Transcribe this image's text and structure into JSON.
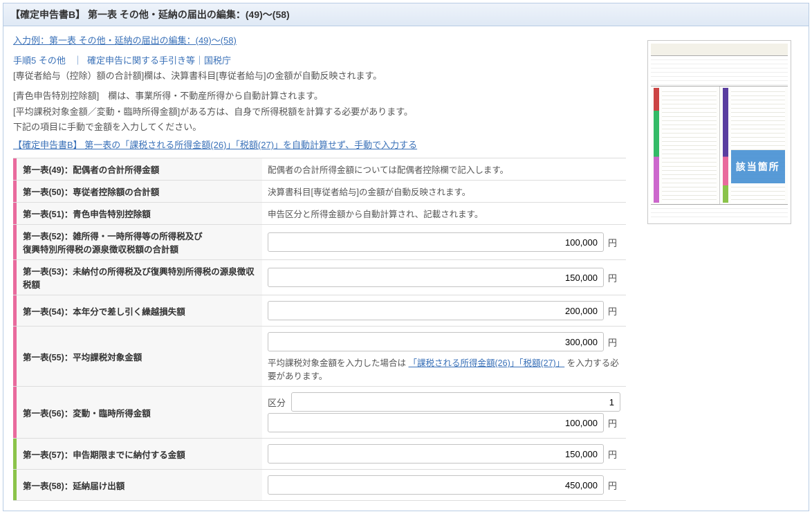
{
  "header": {
    "title": "【確定申告書B】 第一表 その他・延納の届出の編集：(49)～(58)"
  },
  "intro": {
    "example_link": "入力例：第一表 その他・延納の届出の編集：(49)～(58)",
    "link1": "手順5 その他",
    "link_sep": "｜",
    "link2": "確定申告に関する手引き等｜国税庁",
    "desc1": "[専従者給与（控除）額の合計額]欄は、決算書科目[専従者給与]の金額が自動反映されます。",
    "desc2": "[青色申告特別控除額]　欄は、事業所得・不動産所得から自動計算されます。",
    "desc3": "[平均課税対象金額／変動・臨時所得金額]がある方は、自身で所得税額を計算する必要があります。",
    "desc4": "下記の項目に手動で金額を入力してください。",
    "desc5_link": "【確定申告書B】 第一表の「課税される所得金額(26)」「税額(27)」を自動計算せず、手動で入力する"
  },
  "rows": {
    "r49_label": "第一表(49)：配偶者の合計所得金額",
    "r49_text": "配偶者の合計所得金額については配偶者控除欄で記入します。",
    "r50_label": "第一表(50)：専従者控除額の合計額",
    "r50_text": "決算書科目[専従者給与]の金額が自動反映されます。",
    "r51_label": "第一表(51)：青色申告特別控除額",
    "r51_text": "申告区分と所得金額から自動計算され、記載されます。",
    "r52_label": "第一表(52)：雑所得・一時所得等の所得税及び\n復興特別所得税の源泉徴収税額の合計額",
    "r52_value": "100,000",
    "r53_label": "第一表(53)：未納付の所得税及び復興特別所得税の源泉徴収税額",
    "r53_value": "150,000",
    "r54_label": "第一表(54)：本年分で差し引く繰越損失額",
    "r54_value": "200,000",
    "r55_label": "第一表(55)：平均課税対象金額",
    "r55_value": "300,000",
    "r55_note_pre": "平均課税対象金額を入力した場合は",
    "r55_note_link": "「課税される所得金額(26)」「税額(27)」",
    "r55_note_post": "を入力する必要があります。",
    "r56_label": "第一表(56)：変動・臨時所得金額",
    "r56_kubun_label": "区分",
    "r56_kubun_value": "1",
    "r56_value": "100,000",
    "r57_label": "第一表(57)：申告期限までに納付する金額",
    "r57_value": "150,000",
    "r58_label": "第一表(58)：延納届け出額",
    "r58_value": "450,000",
    "yen": "円"
  },
  "thumb": {
    "overlay": "該当箇所"
  }
}
